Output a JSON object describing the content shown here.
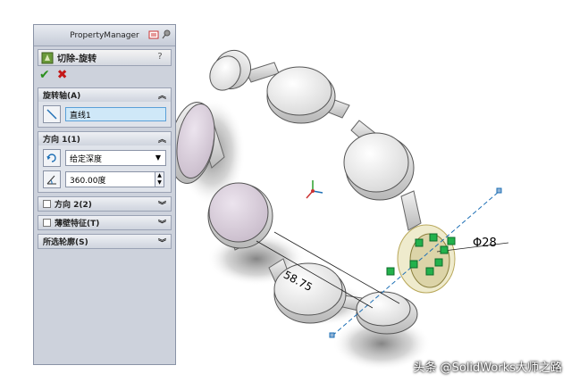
{
  "panel": {
    "title": "PropertyManager",
    "feature_name": "切除-旋转",
    "help": "?",
    "ok_symbol": "✔",
    "cancel_symbol": "✖"
  },
  "groups": {
    "axis": {
      "title": "旋转轴(A)",
      "value": "直线1"
    },
    "direction1": {
      "title": "方向 1(1)",
      "end_condition": "给定深度",
      "angle": "360.00度"
    },
    "direction2": {
      "title": "方向 2(2)"
    },
    "thin": {
      "title": "薄壁特征(T)"
    },
    "contours": {
      "title": "所选轮廓(S)"
    }
  },
  "viewport": {
    "dimension_diameter": "Φ28",
    "dimension_length": "58.75",
    "watermark": "头条 @SolidWorks大师之路"
  },
  "colors": {
    "panel_bg": "#cdd2dc",
    "field_highlight": "#cfe8f8",
    "ok": "#2a8f1d",
    "cancel": "#c41818",
    "handle_green": "#22b14c"
  }
}
